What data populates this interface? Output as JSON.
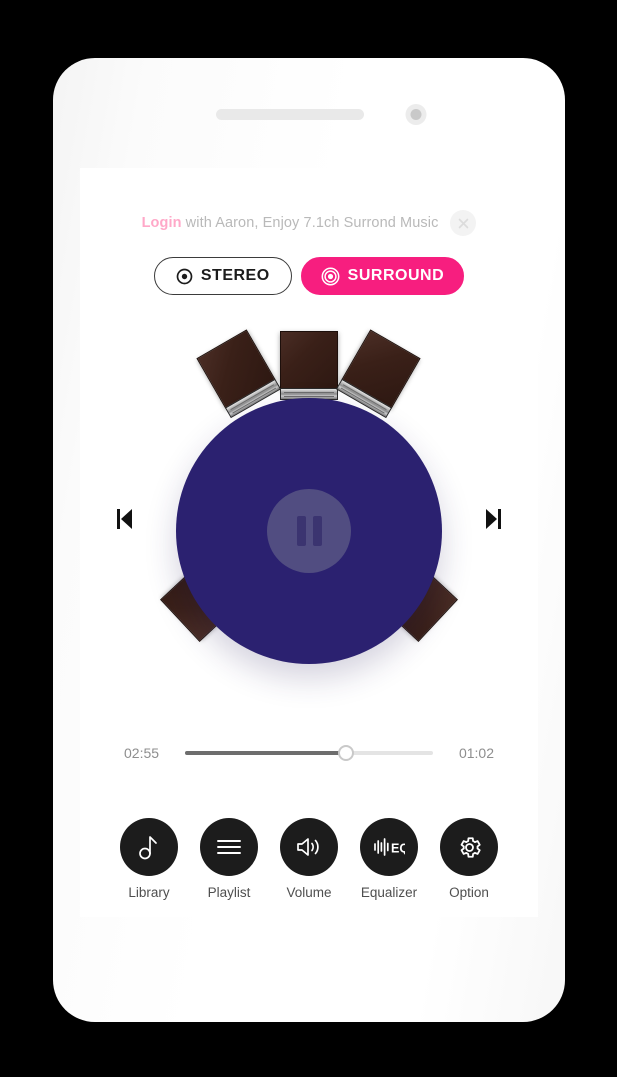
{
  "device": {
    "earpiece": "earpiece-speaker",
    "camera": "front-camera"
  },
  "banner": {
    "login_label": "Login",
    "message": " with Aaron, Enjoy 7.1ch Surrond Music",
    "close_label": "×",
    "login_color": "#ffa8c8",
    "text_color": "#b9b9b9"
  },
  "modes": {
    "stereo": {
      "label": "STEREO",
      "selected": false
    },
    "surround": {
      "label": "SURROUND",
      "selected": true,
      "accent": "#f71e7f"
    }
  },
  "player": {
    "state": "playing",
    "disc_color": "#2b2170",
    "center_color": "#514d81",
    "pause_label": "Pause",
    "prev_label": "Previous track",
    "next_label": "Next track",
    "speaker_count": 5,
    "speakers": [
      {
        "id": "front-left"
      },
      {
        "id": "front-center"
      },
      {
        "id": "front-right"
      },
      {
        "id": "rear-left"
      },
      {
        "id": "rear-right"
      }
    ]
  },
  "progress": {
    "elapsed": "02:55",
    "remaining": "01:02",
    "percent": 65
  },
  "nav": {
    "items": [
      {
        "label": "Library",
        "icon": "music-note-icon"
      },
      {
        "label": "Playlist",
        "icon": "hamburger-list-icon"
      },
      {
        "label": "Volume",
        "icon": "speaker-volume-icon"
      },
      {
        "label": "Equalizer",
        "icon": "equalizer-eq-icon",
        "text": "EQ"
      },
      {
        "label": "Option",
        "icon": "gear-icon"
      }
    ]
  }
}
